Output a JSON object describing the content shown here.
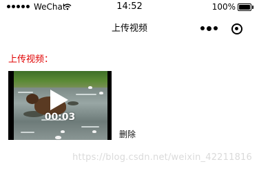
{
  "status_bar": {
    "carrier": "WeChat",
    "time": "14:52",
    "battery": "100%",
    "battery_level": 1.0,
    "signal_bars_filled": 5,
    "icons": [
      "signal-dots-icon",
      "wifi-icon",
      "battery-icon"
    ]
  },
  "nav": {
    "title": "上传视频",
    "icons": [
      "more-icon",
      "close-icon"
    ]
  },
  "upload": {
    "label": "上传视频：",
    "video": {
      "duration": "00:03",
      "icon": "play-icon"
    },
    "delete_label": "删除"
  },
  "watermark": "https://blog.csdn.net/weixin_42211816",
  "colors": {
    "label_red": "#e00000",
    "text": "#000000",
    "background": "#ffffff"
  }
}
